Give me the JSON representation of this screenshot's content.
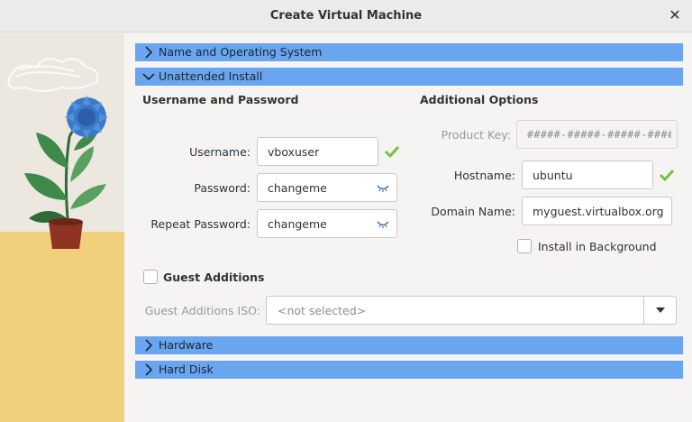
{
  "window": {
    "title": "Create Virtual Machine",
    "close_glyph": "✕"
  },
  "sections": {
    "name_os": {
      "label": "Name and Operating System",
      "expanded": false
    },
    "unattended": {
      "label": "Unattended Install",
      "expanded": true
    },
    "hardware": {
      "label": "Hardware",
      "expanded": false
    },
    "hard_disk": {
      "label": "Hard Disk",
      "expanded": false
    }
  },
  "user_group": {
    "heading": "Username and Password",
    "username_label": "Username:",
    "username_value": "vboxuser",
    "password_label": "Password:",
    "password_value": "changeme",
    "repeat_label": "Repeat Password:",
    "repeat_value": "changeme"
  },
  "options_group": {
    "heading": "Additional Options",
    "product_key_label": "Product Key:",
    "product_key_value": "#####-#####-#####-####",
    "hostname_label": "Hostname:",
    "hostname_value": "ubuntu",
    "domain_label": "Domain Name:",
    "domain_value": "myguest.virtualbox.org",
    "install_bg_label": "Install in Background",
    "install_bg_checked": false
  },
  "guest_additions": {
    "label": "Guest Additions",
    "checked": false,
    "iso_label": "Guest Additions ISO:",
    "iso_value": "<not selected>"
  },
  "colors": {
    "section_bar": "#6aa6f0",
    "valid_check": "#73c23a",
    "sand": "#f2cf7c"
  },
  "icons": [
    "close-icon",
    "chevron-right-icon",
    "chevron-down-icon",
    "checkmark-icon",
    "eye-icon",
    "dropdown-arrow-icon",
    "plant-illustration"
  ]
}
